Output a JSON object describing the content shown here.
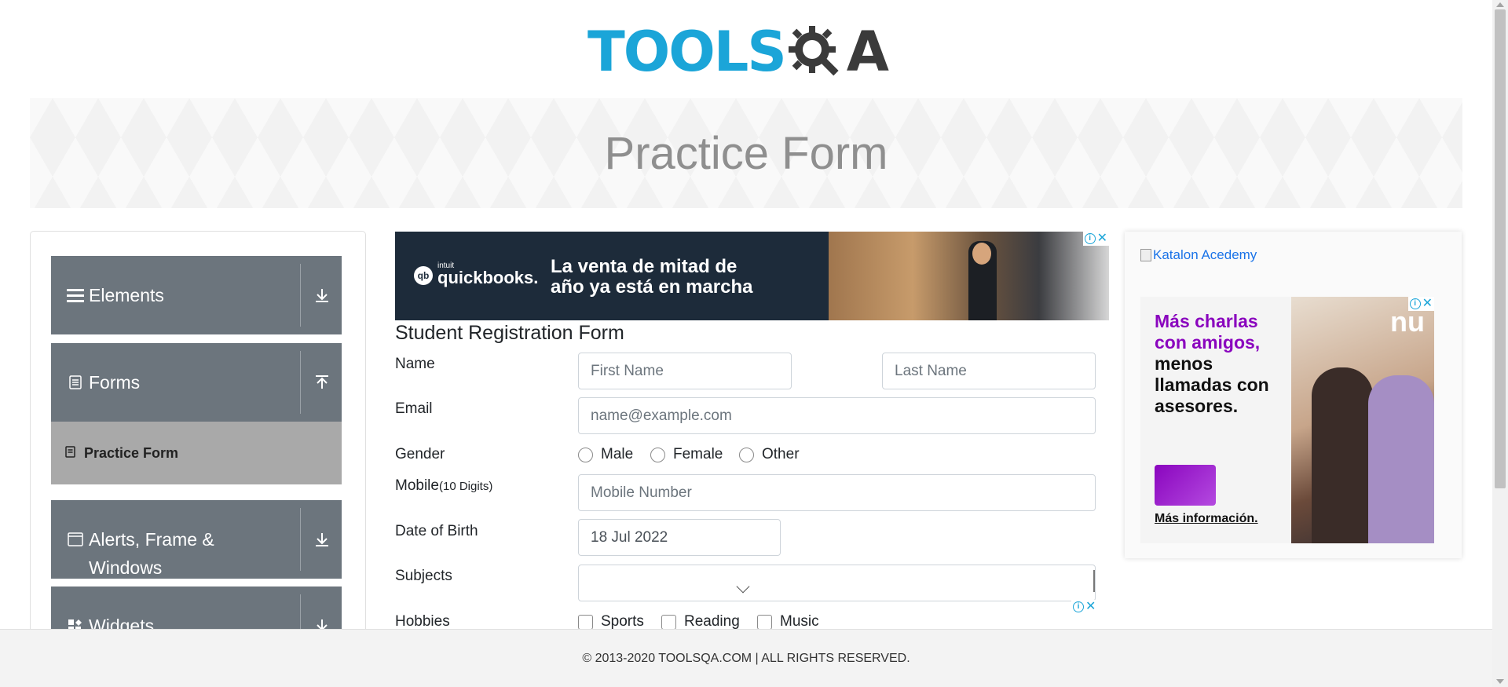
{
  "logo": {
    "part1": "TOOLS",
    "part2": "A"
  },
  "banner": {
    "title": "Practice Form"
  },
  "sidebar": {
    "groups": [
      {
        "label": "Elements",
        "icon": "hamburger-icon",
        "arrow": "download-arrow-icon"
      },
      {
        "label": "Forms",
        "icon": "document-icon",
        "arrow": "upload-arrow-icon"
      },
      {
        "label": "Alerts, Frame &",
        "label2": "Windows",
        "icon": "window-icon",
        "arrow": "download-arrow-icon"
      },
      {
        "label": "Widgets",
        "icon": "widgets-icon",
        "arrow": "download-arrow-icon"
      }
    ],
    "sub_items": [
      {
        "label": "Practice Form",
        "icon": "form-icon"
      }
    ]
  },
  "ads": {
    "top": {
      "brand_small": "intuit",
      "brand": "quickbooks.",
      "logo_mark": "qb",
      "headline1": "La venta de mitad de",
      "headline2": "año ya está en marcha"
    },
    "right": {
      "broken_image_alt": "Katalon Acedemy",
      "nu_line1": "Más charlas",
      "nu_line2": "con amigos,",
      "nu_line3": "menos",
      "nu_line4": "llamadas con",
      "nu_line5": "asesores.",
      "nu_more": "Más información.",
      "nu_logo": "nu"
    },
    "choice_i": "i",
    "choice_x": "✕"
  },
  "form": {
    "title": "Student Registration Form",
    "name_label": "Name",
    "first_name_placeholder": "First Name",
    "last_name_placeholder": "Last Name",
    "email_label": "Email",
    "email_placeholder": "name@example.com",
    "gender_label": "Gender",
    "gender_options": [
      "Male",
      "Female",
      "Other"
    ],
    "mobile_label": "Mobile",
    "mobile_hint": "(10 Digits)",
    "mobile_placeholder": "Mobile Number",
    "dob_label": "Date of Birth",
    "dob_value": "18 Jul 2022",
    "subjects_label": "Subjects",
    "subjects_value": "",
    "hobbies_label": "Hobbies",
    "hobbies_options": [
      "Sports",
      "Reading",
      "Music"
    ]
  },
  "footer": {
    "text": "© 2013-2020 TOOLSQA.COM | ALL RIGHTS RESERVED."
  },
  "colors": {
    "brand_blue": "#1ba5d8",
    "sidebar_gray": "#6c757d",
    "active_item": "#a9a9a9"
  }
}
